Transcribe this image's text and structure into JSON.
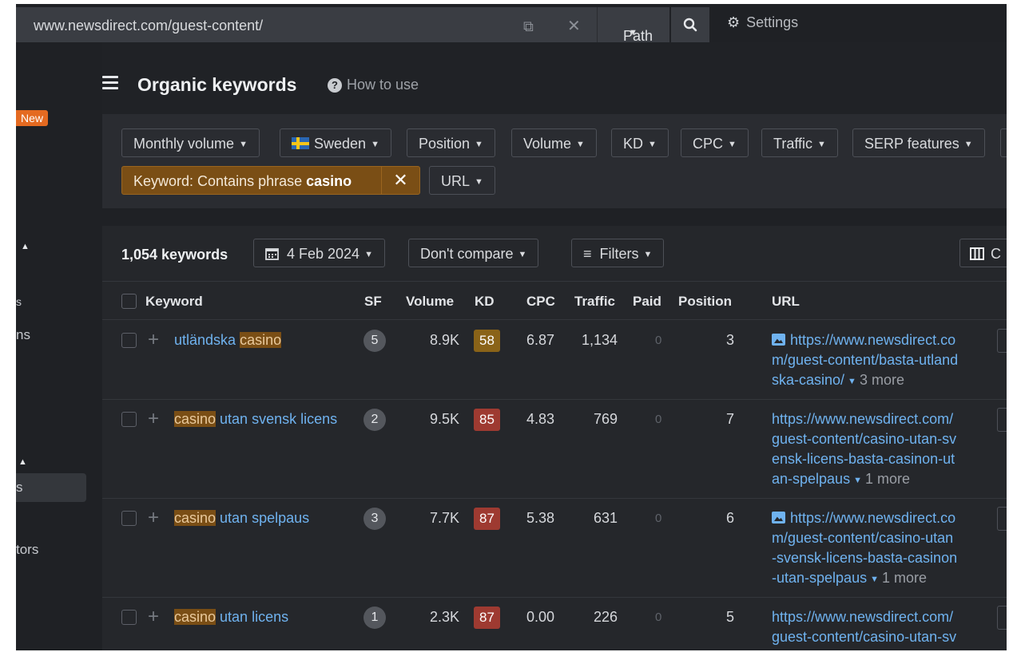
{
  "topbar": {
    "url": "www.newsdirect.com/guest-content/",
    "path_label": "Path",
    "settings_label": "Settings"
  },
  "sidebar": {
    "new_badge": "New",
    "fragments": [
      "s",
      "ns",
      "s",
      "tors"
    ]
  },
  "header": {
    "title": "Organic keywords",
    "how_to_use": "How to use"
  },
  "filters": {
    "buttons": [
      "Monthly volume",
      "Sweden",
      "Position",
      "Volume",
      "KD",
      "CPC",
      "Traffic",
      "SERP features"
    ],
    "keyword_filter_prefix": "Keyword: Contains phrase",
    "keyword_filter_term": "casino",
    "url_button": "URL"
  },
  "toolbar": {
    "count": "1,054 keywords",
    "date": "4 Feb 2024",
    "compare": "Don't compare",
    "filters": "Filters",
    "columns_partial": "C"
  },
  "table": {
    "columns": [
      "Keyword",
      "SF",
      "Volume",
      "KD",
      "CPC",
      "Traffic",
      "Paid",
      "Position",
      "URL"
    ],
    "rows": [
      {
        "kw_parts": [
          {
            "t": "utländska ",
            "h": false
          },
          {
            "t": "casino",
            "h": true
          }
        ],
        "sf": "5",
        "volume": "8.9K",
        "kd": "58",
        "kd_color": "#8a6318",
        "cpc": "6.87",
        "traffic": "1,134",
        "paid": "0",
        "position": "3",
        "url_icon": true,
        "url_lines": [
          "https://www.newsdirect.co",
          "m/guest-content/basta-utland",
          "ska-casino/"
        ],
        "more": "3 more"
      },
      {
        "kw_parts": [
          {
            "t": "casino",
            "h": true
          },
          {
            "t": " utan svensk licens",
            "h": false
          }
        ],
        "sf": "2",
        "volume": "9.5K",
        "kd": "85",
        "kd_color": "#9e3a31",
        "cpc": "4.83",
        "traffic": "769",
        "paid": "0",
        "position": "7",
        "url_icon": false,
        "url_lines": [
          "https://www.newsdirect.com/",
          "guest-content/casino-utan-sv",
          "ensk-licens-basta-casinon-ut",
          "an-spelpaus"
        ],
        "more": "1 more"
      },
      {
        "kw_parts": [
          {
            "t": "casino",
            "h": true
          },
          {
            "t": " utan spelpaus",
            "h": false
          }
        ],
        "sf": "3",
        "volume": "7.7K",
        "kd": "87",
        "kd_color": "#9e3a31",
        "cpc": "5.38",
        "traffic": "631",
        "paid": "0",
        "position": "6",
        "url_icon": true,
        "url_lines": [
          "https://www.newsdirect.co",
          "m/guest-content/casino-utan",
          "-svensk-licens-basta-casinon",
          "-utan-spelpaus"
        ],
        "more": "1 more"
      },
      {
        "kw_parts": [
          {
            "t": "casino",
            "h": true
          },
          {
            "t": " utan licens",
            "h": false
          }
        ],
        "sf": "1",
        "volume": "2.3K",
        "kd": "87",
        "kd_color": "#9e3a31",
        "cpc": "0.00",
        "traffic": "226",
        "paid": "0",
        "position": "5",
        "url_icon": false,
        "url_lines": [
          "https://www.newsdirect.com/",
          "guest-content/casino-utan-sv"
        ],
        "more": ""
      }
    ]
  }
}
